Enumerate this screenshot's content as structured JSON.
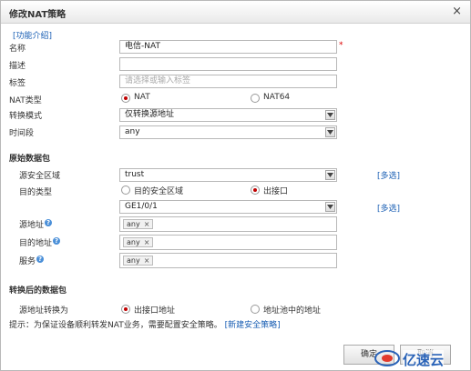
{
  "dialog": {
    "title": "修改NAT策略",
    "close_glyph": "×",
    "intro_link": "[功能介绍]"
  },
  "form": {
    "name_label": "名称",
    "name_value": "电信-NAT",
    "required_mark": "*",
    "desc_label": "描述",
    "desc_value": "",
    "tag_label": "标签",
    "tag_placeholder": "请选择或输入标签",
    "nat_type_label": "NAT类型",
    "nat_type_options": [
      "NAT",
      "NAT64"
    ],
    "nat_type_selected": "NAT",
    "convert_mode_label": "转换模式",
    "convert_mode_value": "仅转换源地址",
    "time_label": "时间段",
    "time_value": "any"
  },
  "original_packet": {
    "section_title": "原始数据包",
    "src_zone_label": "源安全区域",
    "src_zone_value": "trust",
    "multi_select": "[多选]",
    "dst_type_label": "目的类型",
    "dst_type_options": [
      "目的安全区域",
      "出接口"
    ],
    "dst_type_selected": "出接口",
    "interface_value": "GE1/0/1",
    "src_addr_label": "源地址",
    "src_addr_tag": "any",
    "dst_addr_label": "目的地址",
    "dst_addr_tag": "any",
    "service_label": "服务",
    "service_tag": "any",
    "help_glyph": "?",
    "remove_glyph": "×"
  },
  "translated_packet": {
    "section_title": "转换后的数据包",
    "src_convert_label": "源地址转换为",
    "src_convert_options": [
      "出接口地址",
      "地址池中的地址"
    ],
    "src_convert_selected": "出接口地址"
  },
  "hint": {
    "text": "提示：为保证设备顺利转发NAT业务，需要配置安全策略。",
    "link": "[新建安全策略]"
  },
  "buttons": {
    "ok": "确定",
    "cancel": "取消"
  },
  "watermark": {
    "text": "亿速云"
  },
  "colors": {
    "link": "#1a5fb4",
    "radio_selected": "#c00000",
    "required": "#dd0000",
    "help_icon": "#4a8fd8"
  }
}
